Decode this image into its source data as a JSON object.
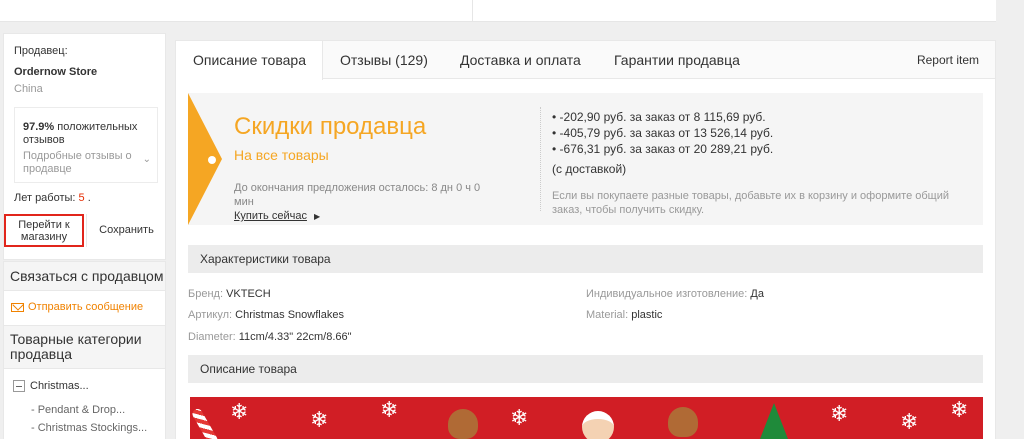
{
  "seller": {
    "label": "Продавец:",
    "name": "Ordernow Store",
    "country": "China",
    "positive_pct": "97.9%",
    "positive_text": "положительных отзывов",
    "detailed_feedback": "Подробные отзывы о продавце",
    "years_label": "Лет работы:",
    "years_value": "5",
    "years_suffix": ".",
    "go_store_label": "Перейти к магазину",
    "save_label": "Сохранить"
  },
  "contact": {
    "title": "Связаться с продавцом",
    "send_message": "Отправить сообщение"
  },
  "categories": {
    "title": "Товарные категории продавца",
    "root": "Christmas...",
    "items": [
      "- Pendant & Drop...",
      "- Christmas Stockings..."
    ]
  },
  "tabs": {
    "items": [
      "Описание товара",
      "Отзывы (129)",
      "Доставка и оплата",
      "Гарантии продавца"
    ],
    "report": "Report item"
  },
  "promo": {
    "title": "Скидки продавца",
    "subtitle": "На все товары",
    "time_left": "До окончания предложения осталось: 8 дн 0 ч 0 мин",
    "buy_now": "Купить сейчас",
    "discounts": [
      "• -202,90 руб. за заказ от 8 115,69 руб.",
      "• -405,79 руб. за заказ от 13 526,14 руб.",
      "• -676,31 руб. за заказ от 20 289,21 руб."
    ],
    "with_delivery": "(с доставкой)",
    "note": "Если вы покупаете разные товары, добавьте их в корзину и оформите общий заказ, чтобы получить скидку.",
    "accent": "#f5a623"
  },
  "specs": {
    "title": "Характеристики товара",
    "brand_label": "Бренд:",
    "brand_value": "VKTECH",
    "article_label": "Артикул:",
    "article_value": "Christmas Snowflakes",
    "diameter_label": "Diameter:",
    "diameter_value": "11cm/4.33\" 22cm/8.66\"",
    "custom_label": "Индивидуальное изготовление:",
    "custom_value": "Да",
    "material_label": "Material:",
    "material_value": "plastic"
  },
  "description": {
    "title": "Описание товара"
  },
  "colors": {
    "highlight_border": "#e1251b",
    "banner_red": "#d11e25"
  }
}
